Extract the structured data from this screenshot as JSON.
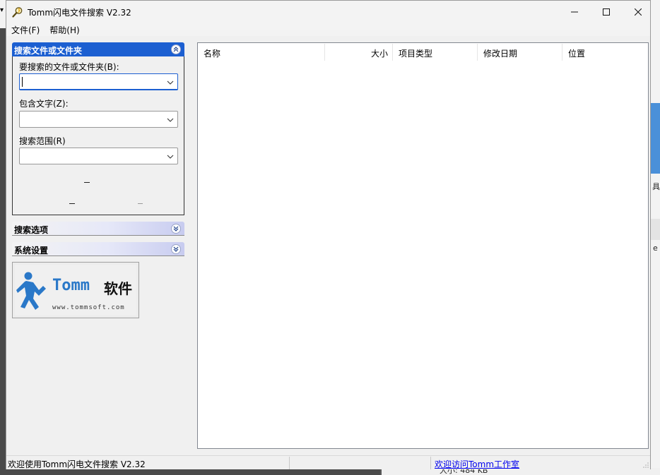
{
  "window": {
    "title": "Tomm闪电文件搜索 V2.32",
    "controls": {
      "minimize": "—",
      "maximize": "☐",
      "close": "✕"
    }
  },
  "menu": [
    {
      "label": "文件(F)"
    },
    {
      "label": "帮助(H)"
    }
  ],
  "search_panel": {
    "header": "搜索文件或文件夹",
    "expand_glyph": "⌃",
    "name_label": "要搜索的文件或文件夹(B):",
    "name_value": "",
    "contains_label": "包含文字(Z):",
    "contains_value": "",
    "scope_label": "搜索范围(R)",
    "scope_value": ""
  },
  "options_panel": {
    "header": "搜索选项",
    "expand_glyph": "⌄"
  },
  "settings_panel": {
    "header": "系统设置",
    "expand_glyph": "⌄"
  },
  "logo": {
    "brand": "Tomm",
    "brand_cn": "软件",
    "url": "www.tommsoft.com"
  },
  "results": {
    "columns": [
      {
        "label": "名称"
      },
      {
        "label": "大小"
      },
      {
        "label": "项目类型"
      },
      {
        "label": "修改日期"
      },
      {
        "label": "位置"
      }
    ],
    "rows": []
  },
  "statusbar": {
    "message": "欢迎使用Tomm闪电文件搜索 V2.32",
    "link": "欢迎访问Tomm工作室"
  },
  "background": {
    "right_char_1": "具",
    "right_char_2": "e",
    "bottom_text": "大小: 484 KB"
  }
}
